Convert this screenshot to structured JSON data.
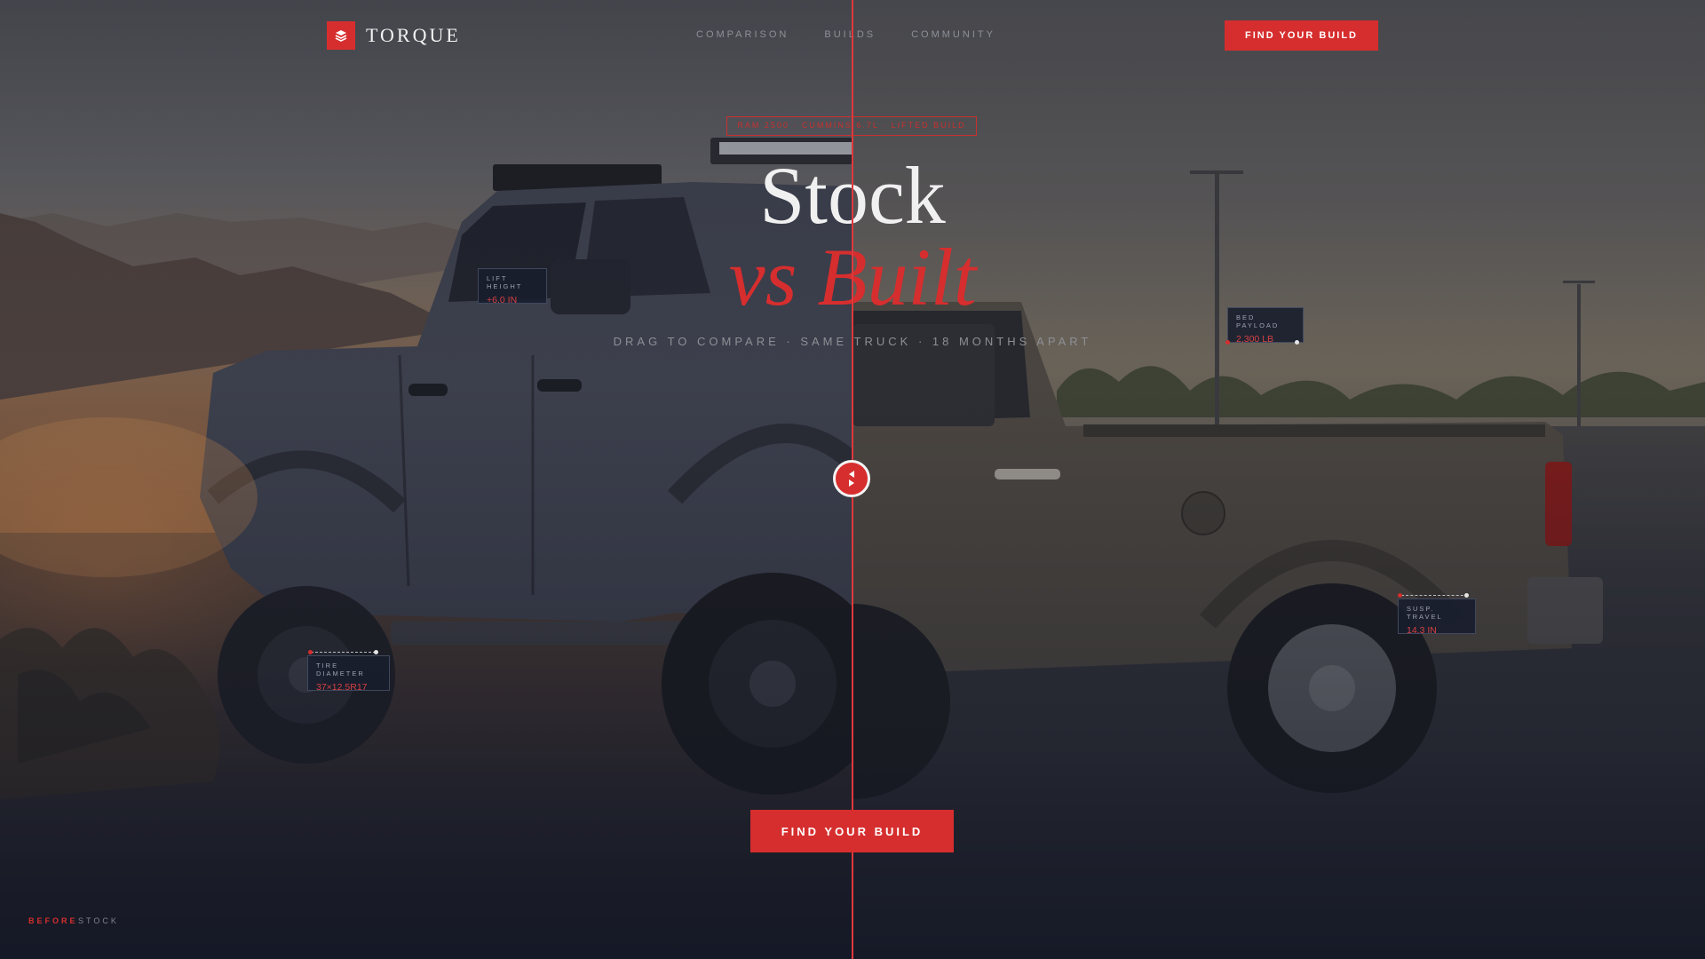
{
  "nav": {
    "brand": "TORQUE",
    "links": [
      "COMPARISON",
      "BUILDS",
      "COMMUNITY"
    ],
    "cta_label": "FIND YOUR BUILD"
  },
  "hero": {
    "badge": "RAM 2500 · CUMMINS 6.7L · LIFTED BUILD",
    "title_line1": "Stock",
    "title_line2": "vs Built",
    "subtitle": "DRAG TO COMPARE · SAME TRUCK · 18 MONTHS APART",
    "cta_label": "FIND YOUR BUILD"
  },
  "specs": {
    "lift": {
      "label": "LIFT HEIGHT",
      "value": "+6.0 IN"
    },
    "tire": {
      "label": "TIRE DIAMETER",
      "value": "37×12.5R17"
    },
    "payload": {
      "label": "BED PAYLOAD",
      "value": "2,300 LB"
    },
    "susp": {
      "label": "SUSP. TRAVEL",
      "value": "14.3 IN"
    }
  },
  "corner": {
    "left_a": "BEFORE",
    "left_b": "STOCK"
  },
  "colors": {
    "accent": "#d62e2e",
    "divider": "#e0383b",
    "panel": "#181e2e"
  },
  "icons": {
    "logo": "layers-icon",
    "handle": "arrows-left-right-icon"
  }
}
